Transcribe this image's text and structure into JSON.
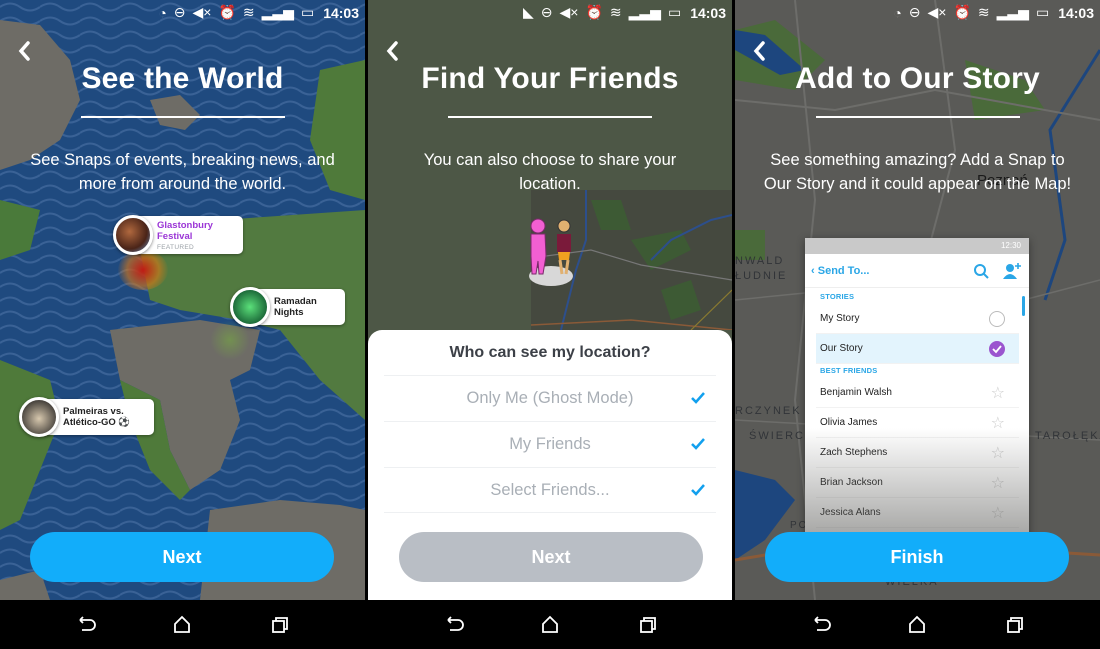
{
  "status_bar": {
    "time": "14:03"
  },
  "panels": [
    {
      "title": "See the World",
      "subtitle": "See Snaps of events, breaking news, and more from around the world.",
      "button": "Next",
      "map_pins": [
        {
          "title": "Glastonbury Festival",
          "sub": "FEATURED",
          "featured": true
        },
        {
          "title": "Ramadan Nights",
          "sub": ""
        },
        {
          "title": "Palmeiras vs. Atlético-GO",
          "sub": "",
          "icon": "soccer-ball-icon"
        }
      ]
    },
    {
      "title": "Find Your Friends",
      "subtitle": "You can also choose to share your location.",
      "sheet": {
        "title": "Who can see my location?",
        "options": [
          {
            "label": "Only Me (Ghost Mode)",
            "checked": true
          },
          {
            "label": "My Friends",
            "checked": true
          },
          {
            "label": "Select Friends...",
            "checked": true
          }
        ]
      },
      "button": "Next"
    },
    {
      "title": "Add to Our Story",
      "subtitle": "See something amazing? Add a Snap to Our Story and it could appear on the Map!",
      "map_labels": [
        "Poznań",
        "NWALD",
        "ŁUDNIE",
        "RCZYNEK",
        "ŚWIERC",
        "POWSTAŃCÓW",
        "WIELKA",
        "TAROŁĘKA"
      ],
      "phone": {
        "status_time": "12:30",
        "header": "Send To...",
        "stories_label": "STORIES",
        "stories": [
          {
            "name": "My Story",
            "selected": false
          },
          {
            "name": "Our Story",
            "selected": true
          }
        ],
        "best_friends_label": "BEST FRIENDS",
        "friends": [
          "Benjamin Walsh",
          "Olivia James",
          "Zach Stephens",
          "Brian Jackson",
          "Jessica Alans"
        ]
      },
      "button": "Finish"
    }
  ],
  "colors": {
    "accent": "#12adfa",
    "disabled": "#b9bec5",
    "featured": "#9b36d6",
    "ocean": "#1f4a7f"
  }
}
